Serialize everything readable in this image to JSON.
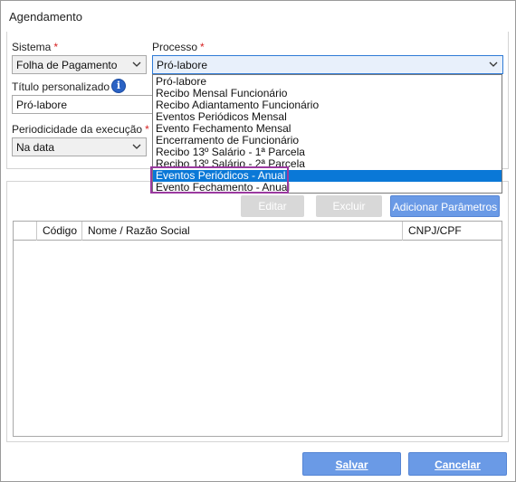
{
  "window": {
    "title": "Agendamento"
  },
  "form": {
    "sistema": {
      "label": "Sistema",
      "required_mark": "*",
      "value": "Folha de Pagamento"
    },
    "processo": {
      "label": "Processo",
      "required_mark": "*",
      "value": "Pró-labore"
    },
    "titulo": {
      "label": "Título personalizado",
      "required_mark": "*",
      "value": "Pró-labore",
      "info_icon": "info-icon"
    },
    "periodicidade": {
      "label": "Periodicidade da execução",
      "required_mark": "*",
      "value": "Na data"
    }
  },
  "processo_options": [
    {
      "label": "Pró-labore",
      "selected": false
    },
    {
      "label": "Recibo Mensal Funcionário",
      "selected": false
    },
    {
      "label": "Recibo Adiantamento Funcionário",
      "selected": false
    },
    {
      "label": "Eventos Periódicos Mensal",
      "selected": false
    },
    {
      "label": "Evento Fechamento Mensal",
      "selected": false
    },
    {
      "label": "Encerramento de Funcionário",
      "selected": false
    },
    {
      "label": "Recibo 13º Salário - 1ª Parcela",
      "selected": false
    },
    {
      "label": "Recibo 13º Salário - 2ª Parcela",
      "selected": false
    },
    {
      "label": "Eventos Periódicos - Anual",
      "selected": true
    },
    {
      "label": "Evento Fechamento - Anual",
      "selected": false
    }
  ],
  "params": {
    "edit_label": "Editar",
    "delete_label": "Excluir",
    "add_label": "Adicionar Parâmetros",
    "columns": [
      "",
      "Código",
      "Nome / Razão Social",
      "CNPJ/CPF"
    ],
    "rows": []
  },
  "footer": {
    "save_label": "Salvar",
    "cancel_label": "Cancelar"
  },
  "colors": {
    "accent": "#6a9ae6",
    "selection": "#0a78d7",
    "highlight": "#9b3aa0",
    "required": "#d62020"
  }
}
